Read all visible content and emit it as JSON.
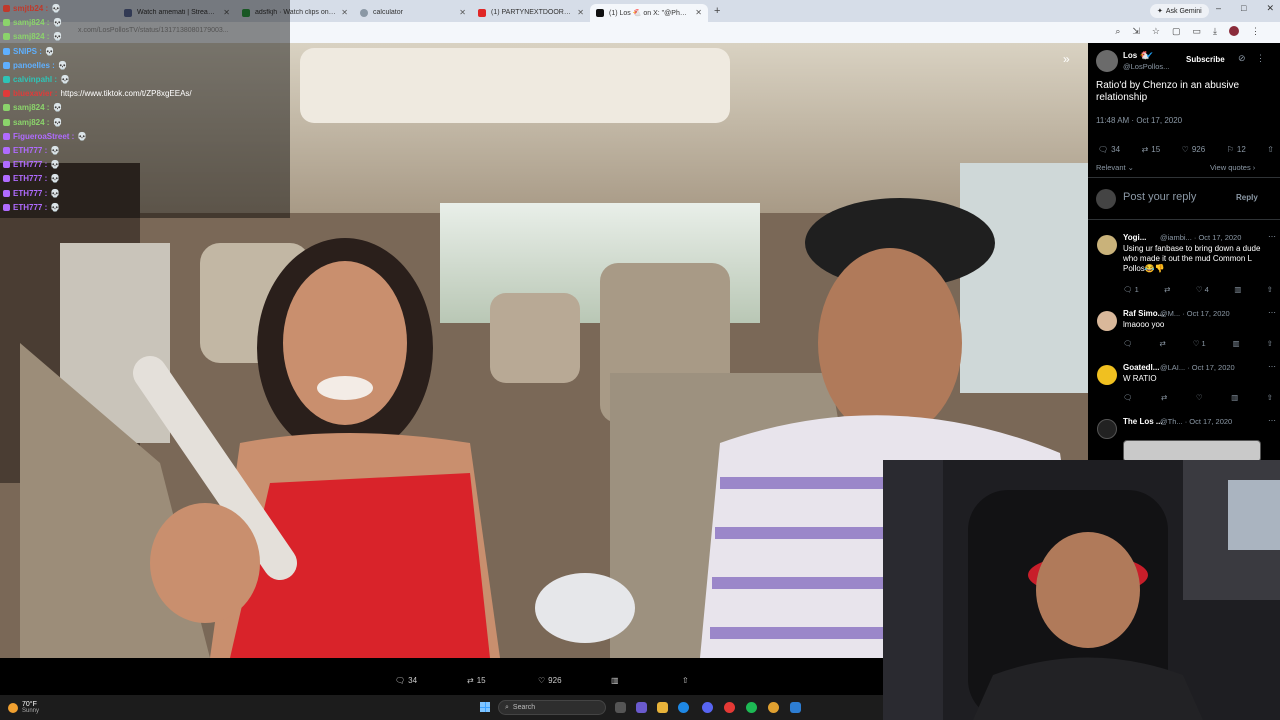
{
  "browser": {
    "tabs": [
      {
        "label": "Watch amemati | Streamable",
        "color": "#5b6b9a"
      },
      {
        "label": "adsfkjh · Watch clips on Kick",
        "color": "#2ea043"
      },
      {
        "label": "calculator",
        "color": "#8b98a5"
      },
      {
        "label": "(1) PARTYNEXTDOOR, Drake",
        "color": "#e02626"
      },
      {
        "label": "(1) Los 🐔 on X: \"@Phontone",
        "color": "#111111"
      }
    ],
    "active_tab": 4,
    "new_tab": "+",
    "url": "x.com/LosPollosTV/status/1317138080179003...",
    "ask_gemini": "Ask Gemini",
    "window_controls": [
      "–",
      "□",
      "✕"
    ]
  },
  "chat": {
    "lines": [
      {
        "user": "smjtb24",
        "msg": "",
        "color": "#c0392b"
      },
      {
        "user": "samj824",
        "msg": "",
        "color": "#8bd46b"
      },
      {
        "user": "samj824",
        "msg": "",
        "color": "#8bd46b"
      },
      {
        "user": "SNIPS",
        "msg": "",
        "color": "#5fb0ff"
      },
      {
        "user": "panoelles",
        "msg": "",
        "color": "#5fb0ff"
      },
      {
        "user": "calvinpahl",
        "msg": "",
        "color": "#2ec4b6"
      },
      {
        "user": "bluexavier",
        "msg": "https://www.tiktok.com/t/ZP8xgEEAs/",
        "color": "#e03a3a"
      },
      {
        "user": "samj824",
        "msg": "",
        "color": "#8bd46b"
      },
      {
        "user": "samj824",
        "msg": "",
        "color": "#8bd46b"
      },
      {
        "user": "FigueroaStreet",
        "msg": "",
        "color": "#b06bff"
      },
      {
        "user": "ETH777",
        "msg": "",
        "color": "#b06bff"
      },
      {
        "user": "ETH777",
        "msg": "",
        "color": "#b06bff"
      },
      {
        "user": "ETH777",
        "msg": "",
        "color": "#b06bff"
      },
      {
        "user": "ETH777",
        "msg": "",
        "color": "#b06bff"
      },
      {
        "user": "ETH777",
        "msg": "",
        "color": "#b06bff"
      }
    ]
  },
  "tweet": {
    "author": "Los 🐔",
    "handle": "@LosPollos...",
    "subscribe": "Subscribe",
    "text": "Ratio'd by Chenzo in an abusive relationship",
    "time": "11:48 AM · Oct 17, 2020",
    "replies": "34",
    "reposts": "15",
    "likes": "926",
    "bookmarks": "12",
    "relevant": "Relevant ⌄",
    "view_quotes": "View quotes ›",
    "post_reply": "Post your reply",
    "reply_button": "Reply"
  },
  "replies": [
    {
      "name": "Yogi...",
      "meta": "@iambi... · Oct 17, 2020",
      "text": "Using ur fanbase to bring down a dude who made it out the mud Common L Pollos😂👎",
      "replies": "1",
      "reposts": "",
      "likes": "4",
      "avatar_color": "#c9b27a"
    },
    {
      "name": "Raf Simo...",
      "meta": "@M... · Oct 17, 2020",
      "text": "lmaooo yoo",
      "replies": "",
      "reposts": "",
      "likes": "1",
      "avatar_color": "#d9b89a"
    },
    {
      "name": "Goatedl...",
      "meta": "@LAI... · Oct 17, 2020",
      "text": "W RATIO",
      "replies": "",
      "reposts": "",
      "likes": "",
      "avatar_color": "#f0c020"
    },
    {
      "name": "The Los ...",
      "meta": "@Th... · Oct 17, 2020",
      "text": "",
      "replies": "",
      "reposts": "",
      "likes": "",
      "avatar_color": "#222222"
    }
  ],
  "video_bar": {
    "replies": "34",
    "reposts": "15",
    "likes": "926"
  },
  "taskbar": {
    "temp": "70°F",
    "condition": "Sunny",
    "search_placeholder": "Search"
  }
}
